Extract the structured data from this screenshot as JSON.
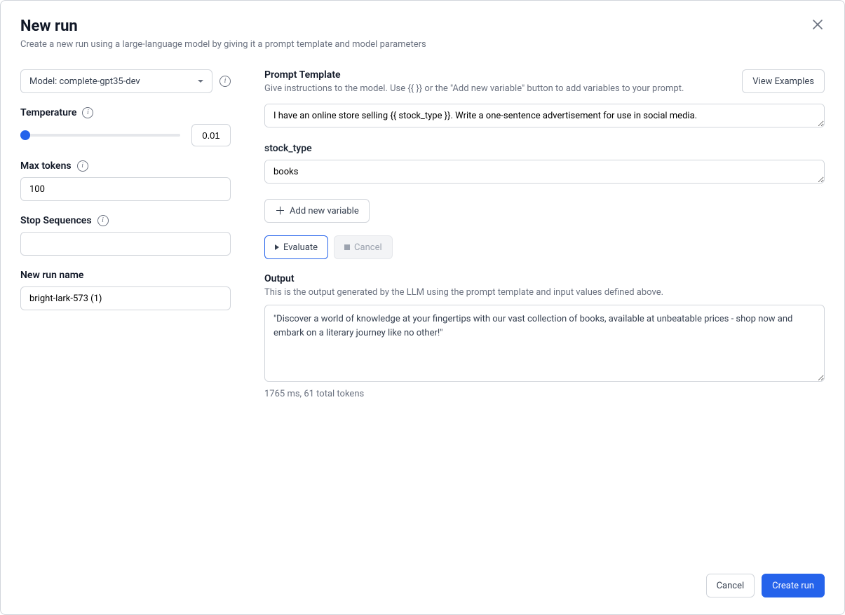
{
  "header": {
    "title": "New run",
    "subtitle": "Create a new run using a large-language model by giving it a prompt template and model parameters"
  },
  "left": {
    "model_label": "Model: complete-gpt35-dev",
    "temperature_label": "Temperature",
    "temperature_value": "0.01",
    "max_tokens_label": "Max tokens",
    "max_tokens_value": "100",
    "stop_sequences_label": "Stop Sequences",
    "stop_sequences_value": "",
    "run_name_label": "New run name",
    "run_name_value": "bright-lark-573 (1)"
  },
  "right": {
    "prompt_template_label": "Prompt Template",
    "prompt_template_help": "Give instructions to the model. Use {{ }} or the \"Add new variable\" button to add variables to your prompt.",
    "view_examples_label": "View Examples",
    "prompt_value": "I have an online store selling {{ stock_type }}. Write a one-sentence advertisement for use in social media.",
    "var_name": "stock_type",
    "var_value": "books",
    "add_variable_label": "Add new variable",
    "evaluate_label": "Evaluate",
    "cancel_eval_label": "Cancel",
    "output_label": "Output",
    "output_help": "This is the output generated by the LLM using the prompt template and input values defined above.",
    "output_value": "\"Discover a world of knowledge at your fingertips with our vast collection of books, available at unbeatable prices - shop now and embark on a literary journey like no other!\"",
    "output_meta": "1765 ms, 61 total tokens"
  },
  "footer": {
    "cancel_label": "Cancel",
    "create_label": "Create run"
  }
}
